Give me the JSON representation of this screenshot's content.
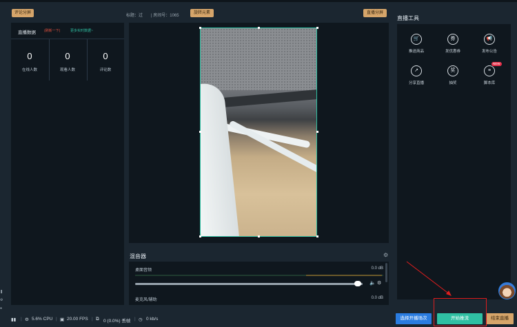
{
  "header": {
    "comment_split_btn": "评论分屏",
    "title_text": "标题：过",
    "room_text": "| 房间号：1065",
    "rotate_btn": "旋转元素",
    "live_split_btn": "直播分屏"
  },
  "left_panel": {
    "title": "直播数据",
    "note": "(刷新一下)",
    "more_link": "更多实时数据~",
    "stats": [
      {
        "value": "0",
        "label": "在线人数"
      },
      {
        "value": "0",
        "label": "观看人数"
      },
      {
        "value": "0",
        "label": "评论数"
      }
    ]
  },
  "mixer": {
    "title": "混音器",
    "rows": [
      {
        "label": "桌面音频",
        "db": "0.0 dB"
      },
      {
        "label": "麦克风/辅助",
        "db": "0.0 dB"
      }
    ],
    "volume_level": 0.98
  },
  "tools": {
    "title": "直播工具",
    "items": [
      {
        "label": "推送商品",
        "icon": "cart-icon",
        "glyph": "🛒"
      },
      {
        "label": "发优惠券",
        "icon": "coupon-icon",
        "glyph": "券"
      },
      {
        "label": "发布公告",
        "icon": "megaphone-icon",
        "glyph": "📢"
      },
      {
        "label": "分享直播",
        "icon": "share-icon",
        "glyph": "↗"
      },
      {
        "label": "抽奖",
        "icon": "lottery-icon",
        "glyph": "奖"
      },
      {
        "label": "脚本库",
        "icon": "script-icon",
        "glyph": "≡",
        "badge": "NEW"
      }
    ]
  },
  "statusbar": {
    "cpu": "5.6% CPU",
    "fps": "20.00 FPS",
    "dropped": "0 (0.0%) 丢帧",
    "bitrate": "0 kb/s"
  },
  "actions": {
    "select_session": "选择开播场次",
    "start_stream": "开始推流",
    "end_stream": "结束直播"
  },
  "colors": {
    "accent_green": "#2fc0a3",
    "accent_gold": "#d6a56a",
    "accent_blue": "#2a7ce0",
    "annotation_red": "#e01e1e"
  }
}
